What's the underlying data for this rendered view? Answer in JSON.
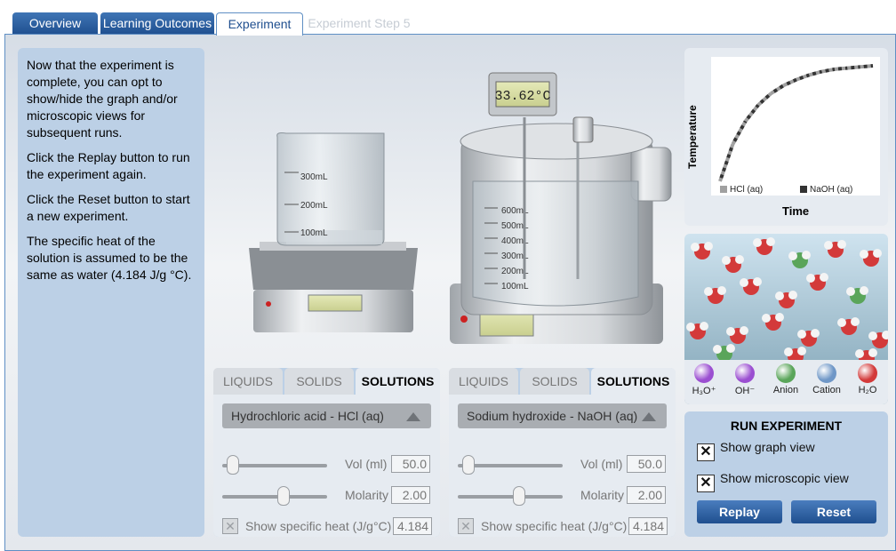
{
  "tabs": {
    "overview": "Overview",
    "learning_outcomes": "Learning Outcomes",
    "experiment": "Experiment",
    "step": "Experiment Step 5"
  },
  "instructions": [
    "Now that the experiment is complete, you can opt to show/hide the graph and/or microscopic views for subsequent runs.",
    "Click the Replay button to run the experiment again.",
    "Click the Reset button to start a new experiment.",
    "The specific heat of the solution is assumed to be the same as water (4.184 J/g °C)."
  ],
  "thermometer": {
    "reading": "33.62°C"
  },
  "beaker_small": {
    "marks": [
      "300mL",
      "200mL",
      "100mL"
    ]
  },
  "calorimeter": {
    "marks": [
      "600mL",
      "500mL",
      "400mL",
      "300mL",
      "200mL",
      "100mL"
    ]
  },
  "panel_left": {
    "tabs": [
      "LIQUIDS",
      "SOLIDS",
      "SOLUTIONS"
    ],
    "active_tab": "SOLUTIONS",
    "selection": "Hydrochloric acid - HCl (aq)",
    "vol_label": "Vol (ml)",
    "vol_value": "50.0",
    "molarity_label": "Molarity",
    "molarity_value": "2.00",
    "specific_heat_label": "Show specific heat  (J/g°C)",
    "specific_heat_value": "4.184",
    "vol_fraction": 0.05,
    "molarity_fraction": 0.6
  },
  "panel_right": {
    "tabs": [
      "LIQUIDS",
      "SOLIDS",
      "SOLUTIONS"
    ],
    "active_tab": "SOLUTIONS",
    "selection": "Sodium hydroxide - NaOH (aq)",
    "vol_label": "Vol (ml)",
    "vol_value": "50.0",
    "molarity_label": "Molarity",
    "molarity_value": "2.00",
    "specific_heat_label": "Show specific heat  (J/g°C)",
    "specific_heat_value": "4.184",
    "vol_fraction": 0.05,
    "molarity_fraction": 0.6
  },
  "graph": {
    "ylabel": "Temperature",
    "xlabel": "Time",
    "legend": [
      {
        "label": "HCl (aq)",
        "color": "#a0a0a0"
      },
      {
        "label": "NaOH (aq)",
        "color": "#333333"
      }
    ]
  },
  "chart_data": {
    "type": "line",
    "title": "",
    "xlabel": "Time",
    "ylabel": "Temperature",
    "series": [
      {
        "name": "HCl (aq)",
        "color": "#a0a0a0",
        "values": [
          0.0,
          0.32,
          0.52,
          0.66,
          0.76,
          0.83,
          0.88,
          0.92,
          0.95,
          0.97,
          0.98,
          0.99,
          1.0
        ]
      },
      {
        "name": "NaOH (aq)",
        "color": "#333333",
        "values": [
          0.0,
          0.32,
          0.52,
          0.66,
          0.76,
          0.83,
          0.88,
          0.92,
          0.95,
          0.97,
          0.98,
          0.99,
          1.0
        ]
      }
    ],
    "grid": false,
    "legend_position": "bottom"
  },
  "ions": [
    {
      "label": "H₃O⁺",
      "color": "#9b4fd1"
    },
    {
      "label": "OH⁻",
      "color": "#9b4fd1"
    },
    {
      "label": "Anion",
      "color": "#5aa55a"
    },
    {
      "label": "Cation",
      "color": "#6f97c7"
    },
    {
      "label": "H₂O",
      "color": "#d33a3a"
    }
  ],
  "run": {
    "title": "RUN EXPERIMENT",
    "show_graph": "Show graph view",
    "show_micro": "Show microscopic view",
    "graph_checked": true,
    "micro_checked": true,
    "replay": "Replay",
    "reset": "Reset"
  }
}
